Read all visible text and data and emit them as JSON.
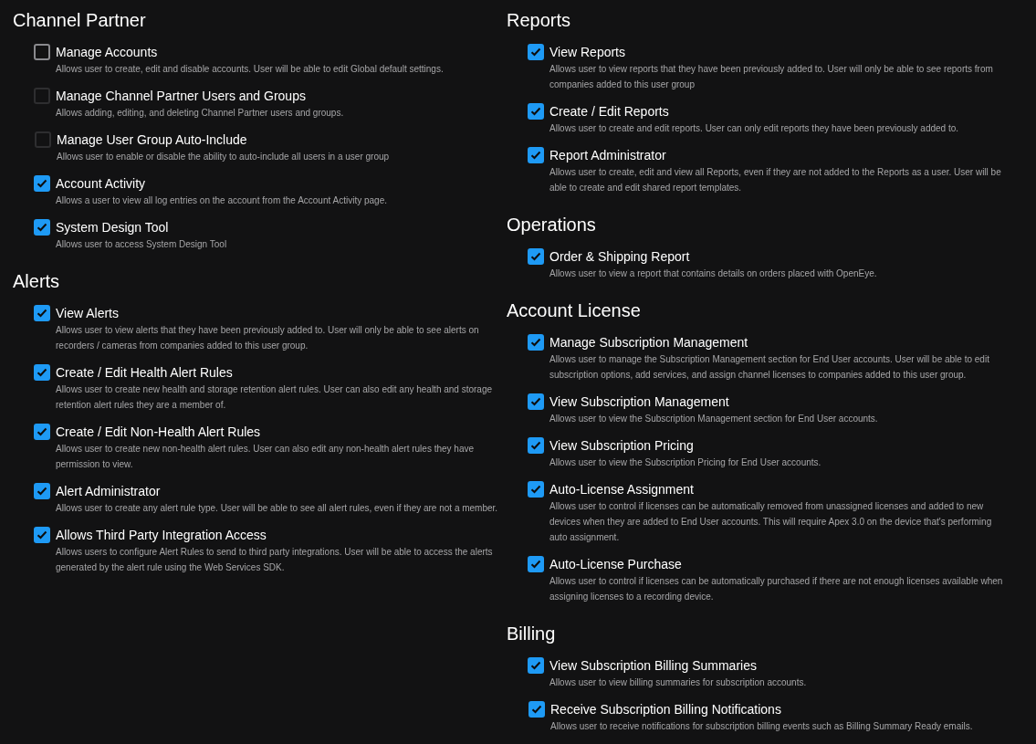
{
  "columns": [
    {
      "sections": [
        {
          "title": "Channel Partner",
          "items": [
            {
              "label": "Manage Accounts",
              "description": "Allows user to create, edit and disable accounts. User will be able to edit Global default settings.",
              "checked": false,
              "disabled": false
            },
            {
              "label": "Manage Channel Partner Users and Groups",
              "description": "Allows adding, editing, and deleting Channel Partner users and groups.",
              "checked": false,
              "disabled": true,
              "children": [
                {
                  "label": "Manage User Group Auto-Include",
                  "description": "Allows user to enable or disable the ability to auto-include all users in a user group",
                  "checked": false,
                  "disabled": true
                }
              ]
            },
            {
              "label": "Account Activity",
              "description": "Allows a user to view all log entries on the account from the Account Activity page.",
              "checked": true,
              "disabled": false
            },
            {
              "label": "System Design Tool",
              "description": "Allows user to access System Design Tool",
              "checked": true,
              "disabled": false
            }
          ]
        },
        {
          "title": "Alerts",
          "items": [
            {
              "label": "View Alerts",
              "description": "Allows user to view alerts that they have been previously added to. User will only be able to see alerts on recorders / cameras from companies added to this user group.",
              "checked": true,
              "disabled": false
            },
            {
              "label": "Create / Edit Health Alert Rules",
              "description": "Allows user to create new health and storage retention alert rules. User can also edit any health and storage retention alert rules they are a member of.",
              "checked": true,
              "disabled": false
            },
            {
              "label": "Create / Edit Non-Health Alert Rules",
              "description": "Allows user to create new non-health alert rules. User can also edit any non-health alert rules they have permission to view.",
              "checked": true,
              "disabled": false
            },
            {
              "label": "Alert Administrator",
              "description": "Allows user to create any alert rule type. User will be able to see all alert rules, even if they are not a member.",
              "checked": true,
              "disabled": false
            },
            {
              "label": "Allows Third Party Integration Access",
              "description": "Allows users to configure Alert Rules to send to third party integrations. User will be able to access the alerts generated by the alert rule using the Web Services SDK.",
              "checked": true,
              "disabled": false
            }
          ]
        }
      ]
    },
    {
      "sections": [
        {
          "title": "Reports",
          "items": [
            {
              "label": "View Reports",
              "description": "Allows user to view reports that they have been previously added to. User will only be able to see reports from companies added to this user group",
              "checked": true,
              "disabled": false
            },
            {
              "label": "Create / Edit Reports",
              "description": "Allows user to create and edit reports. User can only edit reports they have been previously added to.",
              "checked": true,
              "disabled": false
            },
            {
              "label": "Report Administrator",
              "description": "Allows user to create, edit and view all Reports, even if they are not added to the Reports as a user. User will be able to create and edit shared report templates.",
              "checked": true,
              "disabled": false
            }
          ]
        },
        {
          "title": "Operations",
          "items": [
            {
              "label": "Order & Shipping Report",
              "description": "Allows user to view a report that contains details on orders placed with OpenEye.",
              "checked": true,
              "disabled": false
            }
          ]
        },
        {
          "title": "Account License",
          "items": [
            {
              "label": "Manage Subscription Management",
              "description": "Allows user to manage the Subscription Management section for End User accounts. User will be able to edit subscription options, add services, and assign channel licenses to companies added to this user group.",
              "checked": true,
              "disabled": false
            },
            {
              "label": "View Subscription Management",
              "description": "Allows user to view the Subscription Management section for End User accounts.",
              "checked": true,
              "disabled": false
            },
            {
              "label": "View Subscription Pricing",
              "description": "Allows user to view the Subscription Pricing for End User accounts.",
              "checked": true,
              "disabled": false
            },
            {
              "label": "Auto-License Assignment",
              "description": "Allows user to control if licenses can be automatically removed from unassigned licenses and added to new devices when they are added to End User accounts. This will require Apex 3.0 on the device that's performing auto assignment.",
              "checked": true,
              "disabled": false
            },
            {
              "label": "Auto-License Purchase",
              "description": "Allows user to control if licenses can be automatically purchased if there are not enough licenses available when assigning licenses to a recording device.",
              "checked": true,
              "disabled": false
            }
          ]
        },
        {
          "title": "Billing",
          "items": [
            {
              "label": "View Subscription Billing Summaries",
              "description": "Allows user to view billing summaries for subscription accounts.",
              "checked": true,
              "disabled": false,
              "children": [
                {
                  "label": "Receive Subscription Billing Notifications",
                  "description": "Allows user to receive notifications for subscription billing events such as Billing Summary Ready emails.",
                  "checked": true,
                  "disabled": false
                }
              ]
            }
          ]
        }
      ]
    }
  ]
}
